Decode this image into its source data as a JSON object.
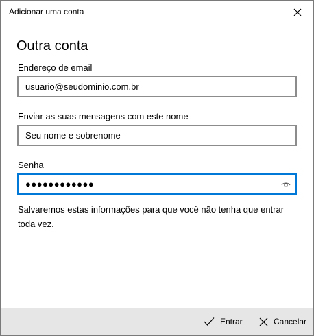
{
  "window": {
    "title": "Adicionar uma conta",
    "close_icon": "close-icon"
  },
  "form": {
    "heading": "Outra conta",
    "email": {
      "label": "Endereço de email",
      "value": "usuario@seudominio.com.br"
    },
    "name": {
      "label": "Enviar as suas mensagens com este nome",
      "value": "Seu nome e sobrenome"
    },
    "password": {
      "label": "Senha",
      "masked_value": "●●●●●●●●●●●●",
      "reveal_icon": "eye-icon"
    },
    "info": "Salvaremos estas informações para que você não tenha que entrar toda vez."
  },
  "footer": {
    "enter_label": "Entrar",
    "enter_icon": "checkmark-icon",
    "cancel_label": "Cancelar",
    "cancel_icon": "close-icon"
  },
  "colors": {
    "focus_border": "#0078d7",
    "field_border": "#8c8c8c",
    "footer_bg": "#e6e6e6"
  }
}
